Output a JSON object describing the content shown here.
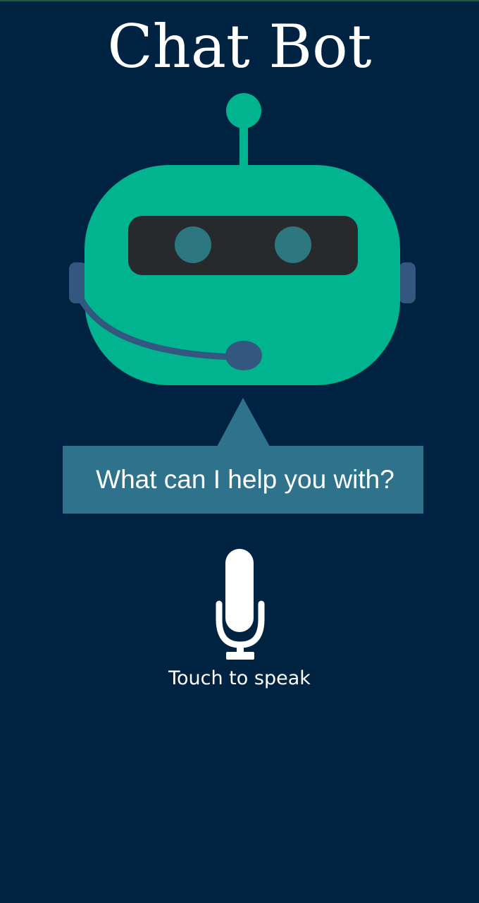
{
  "app": {
    "title": "Chat Bot"
  },
  "assistant": {
    "prompt": "What can I help you with?",
    "avatar_icon": "robot-headset-icon"
  },
  "voice": {
    "mic_icon": "microphone-icon",
    "label": "Touch to speak"
  },
  "colors": {
    "background": "#002341",
    "robot_green": "#00b48f",
    "bubble": "#2f728c",
    "headset": "#33577f",
    "visor": "#272a2d",
    "eyes": "#2d7880",
    "text": "#ffffff"
  }
}
